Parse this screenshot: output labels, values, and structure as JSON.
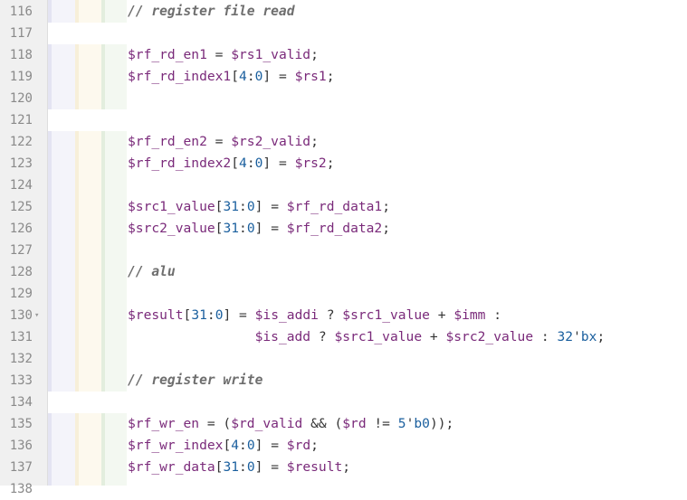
{
  "editor": {
    "lines": [
      {
        "num": "116",
        "segments": [
          {
            "t": "// register file read",
            "c": "comment"
          }
        ]
      },
      {
        "num": "117",
        "segments": []
      },
      {
        "num": "118",
        "segments": [
          {
            "t": "$rf_rd_en1",
            "c": "sig"
          },
          {
            "t": " = ",
            "c": "op"
          },
          {
            "t": "$rs1_valid",
            "c": "sig"
          },
          {
            "t": ";",
            "c": "op"
          }
        ]
      },
      {
        "num": "119",
        "segments": [
          {
            "t": "$rf_rd_index1",
            "c": "sig"
          },
          {
            "t": "[",
            "c": "op"
          },
          {
            "t": "4",
            "c": "num"
          },
          {
            "t": ":",
            "c": "op"
          },
          {
            "t": "0",
            "c": "num"
          },
          {
            "t": "] = ",
            "c": "op"
          },
          {
            "t": "$rs1",
            "c": "sig"
          },
          {
            "t": ";",
            "c": "op"
          }
        ]
      },
      {
        "num": "120",
        "segments": []
      },
      {
        "num": "121",
        "segments": []
      },
      {
        "num": "122",
        "segments": [
          {
            "t": "$rf_rd_en2",
            "c": "sig"
          },
          {
            "t": " = ",
            "c": "op"
          },
          {
            "t": "$rs2_valid",
            "c": "sig"
          },
          {
            "t": ";",
            "c": "op"
          }
        ]
      },
      {
        "num": "123",
        "segments": [
          {
            "t": "$rf_rd_index2",
            "c": "sig"
          },
          {
            "t": "[",
            "c": "op"
          },
          {
            "t": "4",
            "c": "num"
          },
          {
            "t": ":",
            "c": "op"
          },
          {
            "t": "0",
            "c": "num"
          },
          {
            "t": "] = ",
            "c": "op"
          },
          {
            "t": "$rs2",
            "c": "sig"
          },
          {
            "t": ";",
            "c": "op"
          }
        ]
      },
      {
        "num": "124",
        "segments": []
      },
      {
        "num": "125",
        "segments": [
          {
            "t": "$src1_value",
            "c": "sig"
          },
          {
            "t": "[",
            "c": "op"
          },
          {
            "t": "31",
            "c": "num"
          },
          {
            "t": ":",
            "c": "op"
          },
          {
            "t": "0",
            "c": "num"
          },
          {
            "t": "] = ",
            "c": "op"
          },
          {
            "t": "$rf_rd_data1",
            "c": "sig"
          },
          {
            "t": ";",
            "c": "op"
          }
        ]
      },
      {
        "num": "126",
        "segments": [
          {
            "t": "$src2_value",
            "c": "sig"
          },
          {
            "t": "[",
            "c": "op"
          },
          {
            "t": "31",
            "c": "num"
          },
          {
            "t": ":",
            "c": "op"
          },
          {
            "t": "0",
            "c": "num"
          },
          {
            "t": "] = ",
            "c": "op"
          },
          {
            "t": "$rf_rd_data2",
            "c": "sig"
          },
          {
            "t": ";",
            "c": "op"
          }
        ]
      },
      {
        "num": "127",
        "segments": []
      },
      {
        "num": "128",
        "segments": [
          {
            "t": "// alu",
            "c": "comment"
          }
        ]
      },
      {
        "num": "129",
        "segments": []
      },
      {
        "num": "130",
        "fold": true,
        "segments": [
          {
            "t": "$result",
            "c": "sig"
          },
          {
            "t": "[",
            "c": "op"
          },
          {
            "t": "31",
            "c": "num"
          },
          {
            "t": ":",
            "c": "op"
          },
          {
            "t": "0",
            "c": "num"
          },
          {
            "t": "] = ",
            "c": "op"
          },
          {
            "t": "$is_addi",
            "c": "sig"
          },
          {
            "t": " ? ",
            "c": "op"
          },
          {
            "t": "$src1_value",
            "c": "sig"
          },
          {
            "t": " + ",
            "c": "op"
          },
          {
            "t": "$imm",
            "c": "sig"
          },
          {
            "t": " :",
            "c": "op"
          }
        ]
      },
      {
        "num": "131",
        "segments": [
          {
            "t": "                ",
            "c": "op"
          },
          {
            "t": "$is_add",
            "c": "sig"
          },
          {
            "t": " ? ",
            "c": "op"
          },
          {
            "t": "$src1_value",
            "c": "sig"
          },
          {
            "t": " + ",
            "c": "op"
          },
          {
            "t": "$src2_value",
            "c": "sig"
          },
          {
            "t": " : ",
            "c": "op"
          },
          {
            "t": "32",
            "c": "num"
          },
          {
            "t": "'",
            "c": "op"
          },
          {
            "t": "bx",
            "c": "num"
          },
          {
            "t": ";",
            "c": "op"
          }
        ]
      },
      {
        "num": "132",
        "segments": []
      },
      {
        "num": "133",
        "segments": [
          {
            "t": "// register write",
            "c": "comment"
          }
        ]
      },
      {
        "num": "134",
        "segments": []
      },
      {
        "num": "135",
        "segments": [
          {
            "t": "$rf_wr_en",
            "c": "sig"
          },
          {
            "t": " = (",
            "c": "op"
          },
          {
            "t": "$rd_valid",
            "c": "sig"
          },
          {
            "t": " && (",
            "c": "op"
          },
          {
            "t": "$rd",
            "c": "sig"
          },
          {
            "t": " != ",
            "c": "op"
          },
          {
            "t": "5",
            "c": "num"
          },
          {
            "t": "'",
            "c": "op"
          },
          {
            "t": "b0",
            "c": "num"
          },
          {
            "t": "));",
            "c": "op"
          }
        ]
      },
      {
        "num": "136",
        "segments": [
          {
            "t": "$rf_wr_index",
            "c": "sig"
          },
          {
            "t": "[",
            "c": "op"
          },
          {
            "t": "4",
            "c": "num"
          },
          {
            "t": ":",
            "c": "op"
          },
          {
            "t": "0",
            "c": "num"
          },
          {
            "t": "] = ",
            "c": "op"
          },
          {
            "t": "$rd",
            "c": "sig"
          },
          {
            "t": ";",
            "c": "op"
          }
        ]
      },
      {
        "num": "137",
        "segments": [
          {
            "t": "$rf_wr_data",
            "c": "sig"
          },
          {
            "t": "[",
            "c": "op"
          },
          {
            "t": "31",
            "c": "num"
          },
          {
            "t": ":",
            "c": "op"
          },
          {
            "t": "0",
            "c": "num"
          },
          {
            "t": "] = ",
            "c": "op"
          },
          {
            "t": "$result",
            "c": "sig"
          },
          {
            "t": ";",
            "c": "op"
          }
        ]
      },
      {
        "num": "138",
        "segments": []
      }
    ],
    "blank_guide_lines": [
      "117",
      "121",
      "134"
    ],
    "colors": {
      "comment": "#6e6e6e",
      "signal": "#7a2a7a",
      "number": "#1a5f9e",
      "operator": "#333333",
      "gutter": "#f0f0f0"
    },
    "icons": {
      "fold": "chevron-down-icon"
    }
  }
}
